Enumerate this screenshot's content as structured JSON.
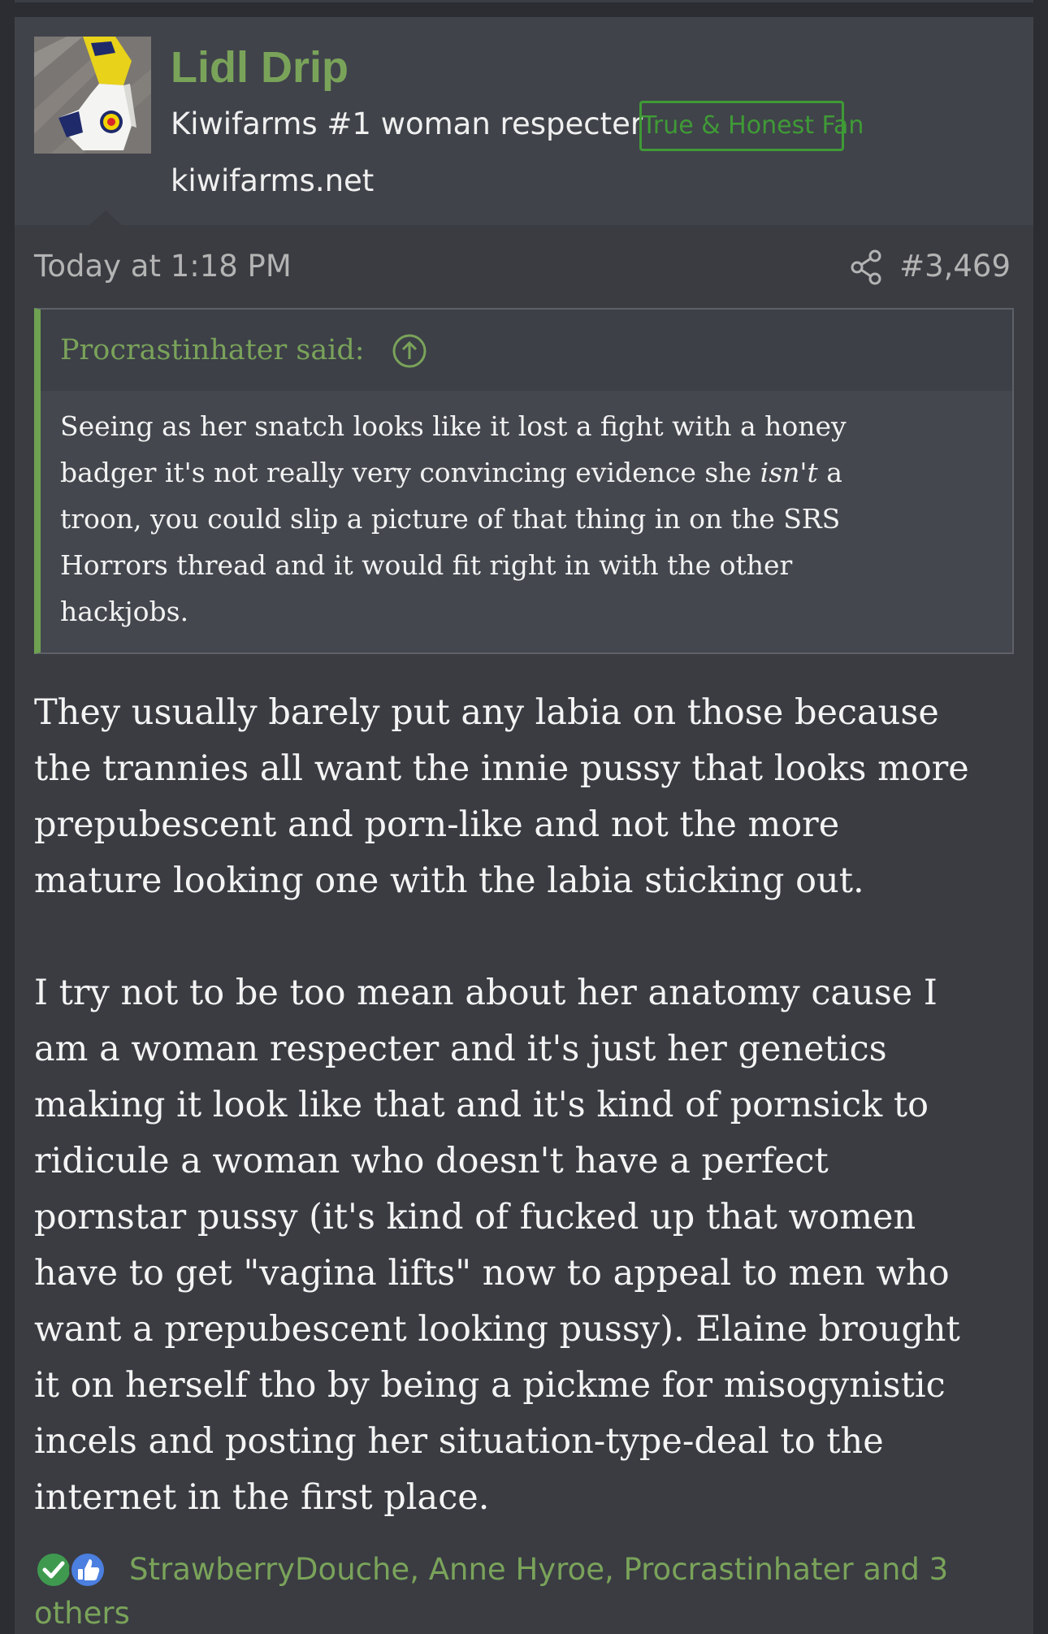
{
  "user": {
    "name": "Lidl Drip",
    "title": "Kiwifarms #1 woman respecter",
    "badge": "True & Honest Fan",
    "location": "kiwifarms.net",
    "avatar_icon": "avatar-image"
  },
  "post": {
    "timestamp": "Today at 1:18 PM",
    "number": "#3,469",
    "share_icon": "share-icon",
    "quote": {
      "author": "Procrastinhater said:",
      "jump_icon": "arrow-up-circle-icon",
      "lines": {
        "l1": "Seeing as her snatch looks like it lost a fight with a honey",
        "l2a": "badger it's not really very convincing evidence she ",
        "l2b": "isn't",
        "l2c": " a",
        "l3": "troon, you could slip a picture of that thing in on the SRS",
        "l4": "Horrors thread and it would fit right in with the other",
        "l5": "hackjobs."
      }
    },
    "body": {
      "p1": [
        "They usually barely put any labia on those because",
        "the trannies all want the innie pussy that looks more",
        "prepubescent and porn-like and not the more",
        "mature looking one with the labia sticking out."
      ],
      "p2": [
        "I try not to be too mean about her anatomy cause I",
        "am a woman respecter and it's just her genetics",
        "making it look like that and it's kind of pornsick to",
        "ridicule a woman who doesn't have a perfect",
        "pornstar pussy (it's kind of fucked up that women",
        "have to get \"vagina lifts\" now to appeal to men who",
        "want a prepubescent looking pussy). Elaine brought",
        "it on herself tho by being a pickme for misogynistic",
        "incels and posting her situation-type-deal to the",
        "internet in the first place."
      ]
    },
    "reactions": {
      "icons": [
        "checkmark-reaction-icon",
        "thumbs-up-reaction-icon"
      ],
      "line1": "StrawberryDouche, Anne Hyroe, Procrastinhater and 3",
      "line2": "others"
    }
  },
  "colors": {
    "background": "#2b2d32",
    "card": "#3a3c42",
    "header": "#40434a",
    "accent_green": "#7aa35a",
    "badge_green": "#3f9a36",
    "quote_bar": "#6fa152",
    "text": "#f4f4f4",
    "muted": "#b4b4b4"
  }
}
